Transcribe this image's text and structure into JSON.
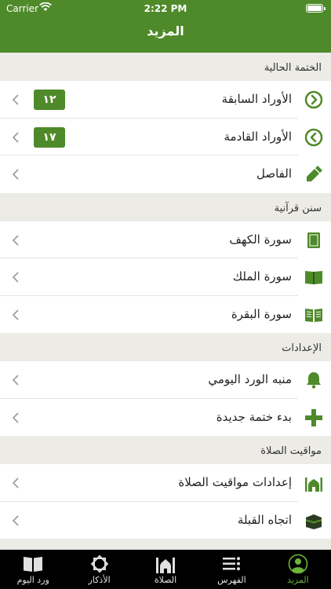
{
  "status": {
    "carrier": "Carrier",
    "time": "2:22 PM"
  },
  "nav": {
    "title": "المزيد"
  },
  "sections": {
    "current_khatma": {
      "title": "الختمة الحالية",
      "items": [
        {
          "label": "الأوراد السابقة",
          "badge": "١٢",
          "icon": "circle-arrow-right-icon"
        },
        {
          "label": "الأوراد القادمة",
          "badge": "١٧",
          "icon": "circle-arrow-left-icon"
        },
        {
          "label": "الفاصل",
          "icon": "bookmark-icon"
        }
      ]
    },
    "quran_sunan": {
      "title": "سنن قرآنية",
      "items": [
        {
          "label": "سورة الكهف",
          "icon": "closed-book-icon"
        },
        {
          "label": "سورة الملك",
          "icon": "open-book-icon"
        },
        {
          "label": "سورة البقرة",
          "icon": "open-book-lines-icon"
        }
      ]
    },
    "settings": {
      "title": "الإعدادات",
      "items": [
        {
          "label": "منبه الورد اليومي",
          "icon": "bell-icon"
        },
        {
          "label": "بدء ختمة جديدة",
          "icon": "plus-icon"
        }
      ]
    },
    "prayer_times": {
      "title": "مواقيت الصلاة",
      "items": [
        {
          "label": "إعدادات مواقيت الصلاة",
          "icon": "mosque-icon"
        },
        {
          "label": "اتجاه القبلة",
          "icon": "kaaba-icon"
        }
      ]
    }
  },
  "tabs": [
    {
      "label": "ورد اليوم",
      "icon": "book-icon"
    },
    {
      "label": "الأذكار",
      "icon": "octagram-icon"
    },
    {
      "label": "الصلاة",
      "icon": "mosque-icon"
    },
    {
      "label": "الفهرس",
      "icon": "list-icon"
    },
    {
      "label": "المزيد",
      "icon": "person-icon",
      "active": true
    }
  ],
  "colors": {
    "primary": "#4f8a2a",
    "tab_active": "#6db53a",
    "background": "#ecebe6"
  }
}
